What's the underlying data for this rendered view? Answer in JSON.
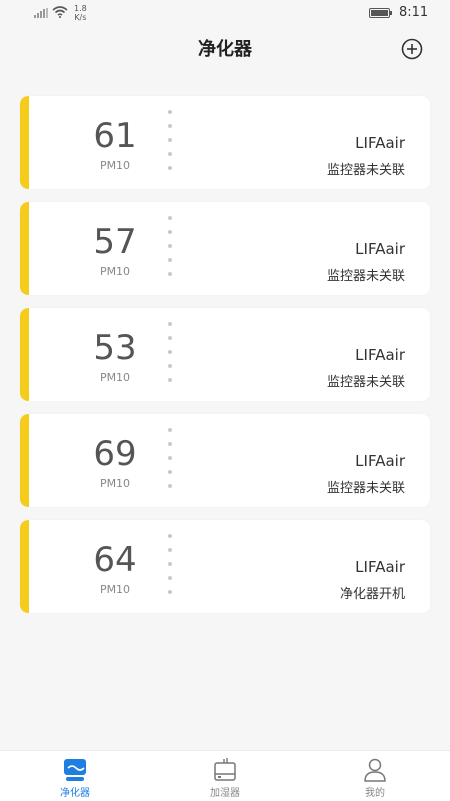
{
  "status_bar": {
    "speed_value": "1.8",
    "speed_unit": "K/s",
    "time": "8:11"
  },
  "header": {
    "title": "净化器",
    "add_icon": "plus-circle-icon"
  },
  "devices": [
    {
      "pm_value": "61",
      "pm_label": "PM10",
      "name": "LIFAair",
      "status": "监控器未关联"
    },
    {
      "pm_value": "57",
      "pm_label": "PM10",
      "name": "LIFAair",
      "status": "监控器未关联"
    },
    {
      "pm_value": "53",
      "pm_label": "PM10",
      "name": "LIFAair",
      "status": "监控器未关联"
    },
    {
      "pm_value": "69",
      "pm_label": "PM10",
      "name": "LIFAair",
      "status": "监控器未关联"
    },
    {
      "pm_value": "64",
      "pm_label": "PM10",
      "name": "LIFAair",
      "status": "净化器开机"
    }
  ],
  "nav": {
    "items": [
      {
        "label": "净化器",
        "icon": "purifier-icon",
        "active": true
      },
      {
        "label": "加湿器",
        "icon": "humidifier-icon",
        "active": false
      },
      {
        "label": "我的",
        "icon": "user-icon",
        "active": false
      }
    ]
  },
  "colors": {
    "accent": "#f5cc1c",
    "active_nav": "#1e7fe0",
    "background": "#f6f6f6"
  }
}
